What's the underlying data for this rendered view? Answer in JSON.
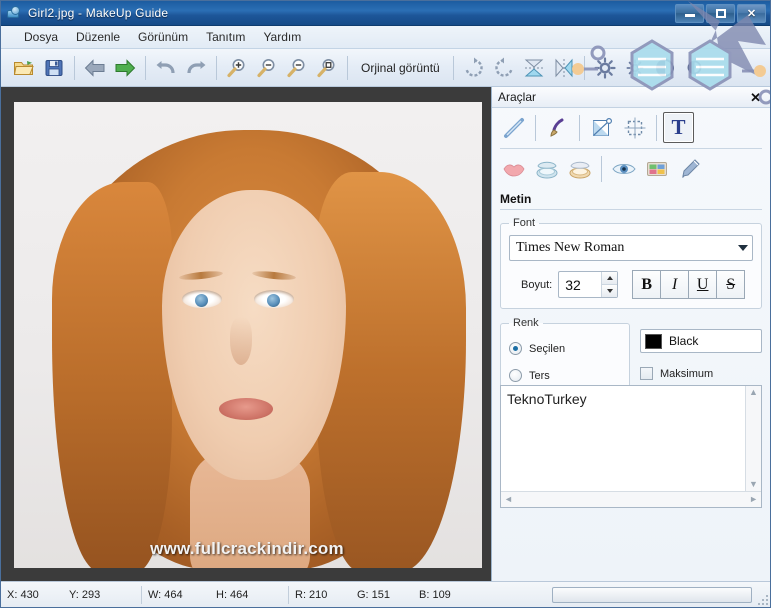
{
  "window": {
    "title": "Girl2.jpg - MakeUp Guide",
    "app_icon": "app-photo-icon",
    "minimize_label": "Minimize",
    "maximize_label": "Maximize",
    "close_label": "Close",
    "close_glyph": "✕"
  },
  "menubar": {
    "items": [
      {
        "label": "Dosya"
      },
      {
        "label": "Düzenle"
      },
      {
        "label": "Görünüm"
      },
      {
        "label": "Tanıtım"
      },
      {
        "label": "Yardım"
      }
    ]
  },
  "toolbar": {
    "original_view_label": "Orjinal görüntü",
    "buttons": [
      {
        "name": "open-file-icon",
        "tip": "Aç"
      },
      {
        "name": "save-file-icon",
        "tip": "Kaydet"
      },
      {
        "name": "back-arrow-icon",
        "tip": "Geri"
      },
      {
        "name": "forward-arrow-icon",
        "tip": "İleri"
      },
      {
        "name": "undo-icon",
        "tip": "Geri al"
      },
      {
        "name": "redo-icon",
        "tip": "Yinele"
      },
      {
        "name": "zoom-in-icon",
        "tip": "Yakınlaştır"
      },
      {
        "name": "zoom-out-icon",
        "tip": "Uzaklaştır"
      },
      {
        "name": "zoom-fit-icon",
        "tip": "Sığdır"
      },
      {
        "name": "zoom-actual-icon",
        "tip": "Gerçek boyut"
      },
      {
        "name": "rotate-right-icon",
        "tip": "Sağa döndür"
      },
      {
        "name": "rotate-left-icon",
        "tip": "Sola döndür"
      },
      {
        "name": "flip-vertical-icon",
        "tip": "Dikey çevir"
      },
      {
        "name": "flip-horizontal-icon",
        "tip": "Yatay çevir"
      },
      {
        "name": "brightness-icon",
        "tip": "Parlaklık"
      },
      {
        "name": "brightness-small-icon",
        "tip": "Parlaklık -"
      },
      {
        "name": "contrast-icon",
        "tip": "Kontrast"
      },
      {
        "name": "contrast-small-icon",
        "tip": "Kontrast -"
      }
    ]
  },
  "canvas": {
    "watermark": "www.fullcrackindir.com",
    "image_name": "Girl2.jpg"
  },
  "panel": {
    "title": "Araçlar",
    "close_glyph": "✕",
    "tools_row1": [
      {
        "name": "line-tool-icon",
        "label": "Çizgi",
        "selected": false
      },
      {
        "name": "brush-tool-icon",
        "label": "Fırça",
        "selected": false
      },
      {
        "name": "gradient-tool-icon",
        "label": "Degrade",
        "selected": false
      },
      {
        "name": "crop-tool-icon",
        "label": "Kırp",
        "selected": false
      },
      {
        "name": "text-tool-icon",
        "label": "T",
        "selected": true
      }
    ],
    "tools_row2": [
      {
        "name": "lips-tool-icon",
        "label": "Dudak"
      },
      {
        "name": "powder-tool-icon",
        "label": "Pudra"
      },
      {
        "name": "blush-tool-icon",
        "label": "Allık"
      },
      {
        "name": "eye-tool-icon",
        "label": "Göz"
      },
      {
        "name": "eyeshadow-palette-icon",
        "label": "Far"
      },
      {
        "name": "pencil-tool-icon",
        "label": "Kalem"
      }
    ],
    "section_title": "Metin",
    "font_group": {
      "legend": "Font",
      "font_family": "Times New Roman",
      "size_label": "Boyut:",
      "size_value": "32",
      "styles": [
        {
          "name": "bold-button",
          "glyph": "B"
        },
        {
          "name": "italic-button",
          "glyph": "I"
        },
        {
          "name": "underline-button",
          "glyph": "U"
        },
        {
          "name": "strikethrough-button",
          "glyph": "S"
        }
      ]
    },
    "color_group": {
      "legend": "Renk",
      "radio_selected": "Seçilen",
      "radio_inverse": "Ters",
      "selected_is_on": true,
      "inverse_is_on": false,
      "color_name": "Black",
      "color_hex": "#000000",
      "maximum_label": "Maksimum",
      "maximum_checked": false
    },
    "text_input": {
      "value": "TeknoTurkey",
      "scroll_up_glyph": "▲",
      "scroll_down_glyph": "▼",
      "scroll_left_glyph": "◄",
      "scroll_right_glyph": "►"
    }
  },
  "statusbar": {
    "cells": [
      {
        "name": "status-x",
        "text": "X: 430"
      },
      {
        "name": "status-y",
        "text": "Y: 293"
      },
      {
        "name": "status-w",
        "text": "W: 464"
      },
      {
        "name": "status-h",
        "text": "H: 464"
      },
      {
        "name": "status-r",
        "text": "R: 210"
      },
      {
        "name": "status-g",
        "text": "G: 151"
      },
      {
        "name": "status-b",
        "text": "B: 109"
      }
    ]
  },
  "colors": {
    "titlebar_blue": "#1d5699",
    "panel_bg": "#eef3f9",
    "canvas_bg": "#3b3b3b",
    "accent": "#1b6ea5"
  }
}
